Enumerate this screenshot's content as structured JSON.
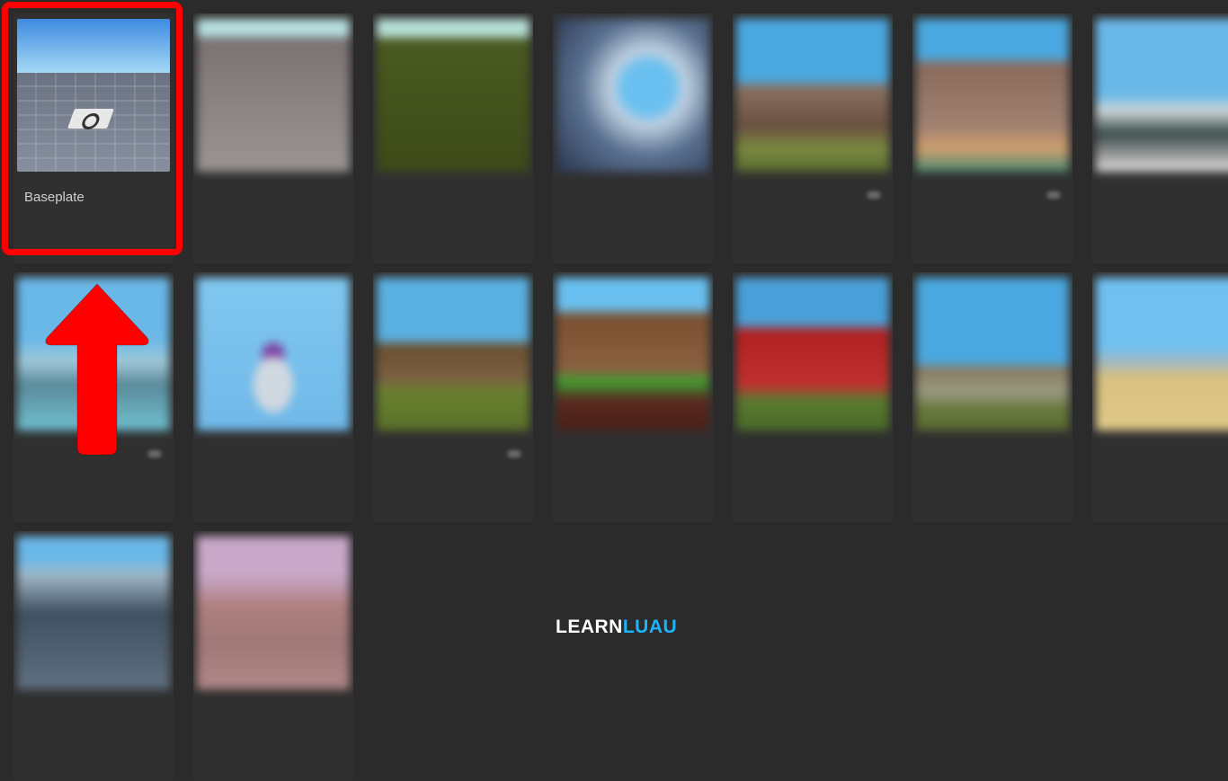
{
  "templates": [
    {
      "label": "Baseplate",
      "highlighted": true
    },
    {
      "label": "",
      "highlighted": false
    },
    {
      "label": "",
      "highlighted": false
    },
    {
      "label": "",
      "highlighted": false
    },
    {
      "label": "",
      "highlighted": false
    },
    {
      "label": "",
      "highlighted": false
    },
    {
      "label": "",
      "highlighted": false
    },
    {
      "label": "",
      "highlighted": false
    },
    {
      "label": "",
      "highlighted": false
    },
    {
      "label": "",
      "highlighted": false
    },
    {
      "label": "",
      "highlighted": false
    },
    {
      "label": "",
      "highlighted": false
    },
    {
      "label": "",
      "highlighted": false
    },
    {
      "label": "",
      "highlighted": false
    },
    {
      "label": "",
      "highlighted": false
    },
    {
      "label": "",
      "highlighted": false
    }
  ],
  "brand": {
    "part1": "LEARN",
    "part2": "LUAU"
  },
  "colors": {
    "highlight": "#ff0000",
    "brand_accent": "#1ab4ff",
    "background": "#2b2b2b"
  }
}
